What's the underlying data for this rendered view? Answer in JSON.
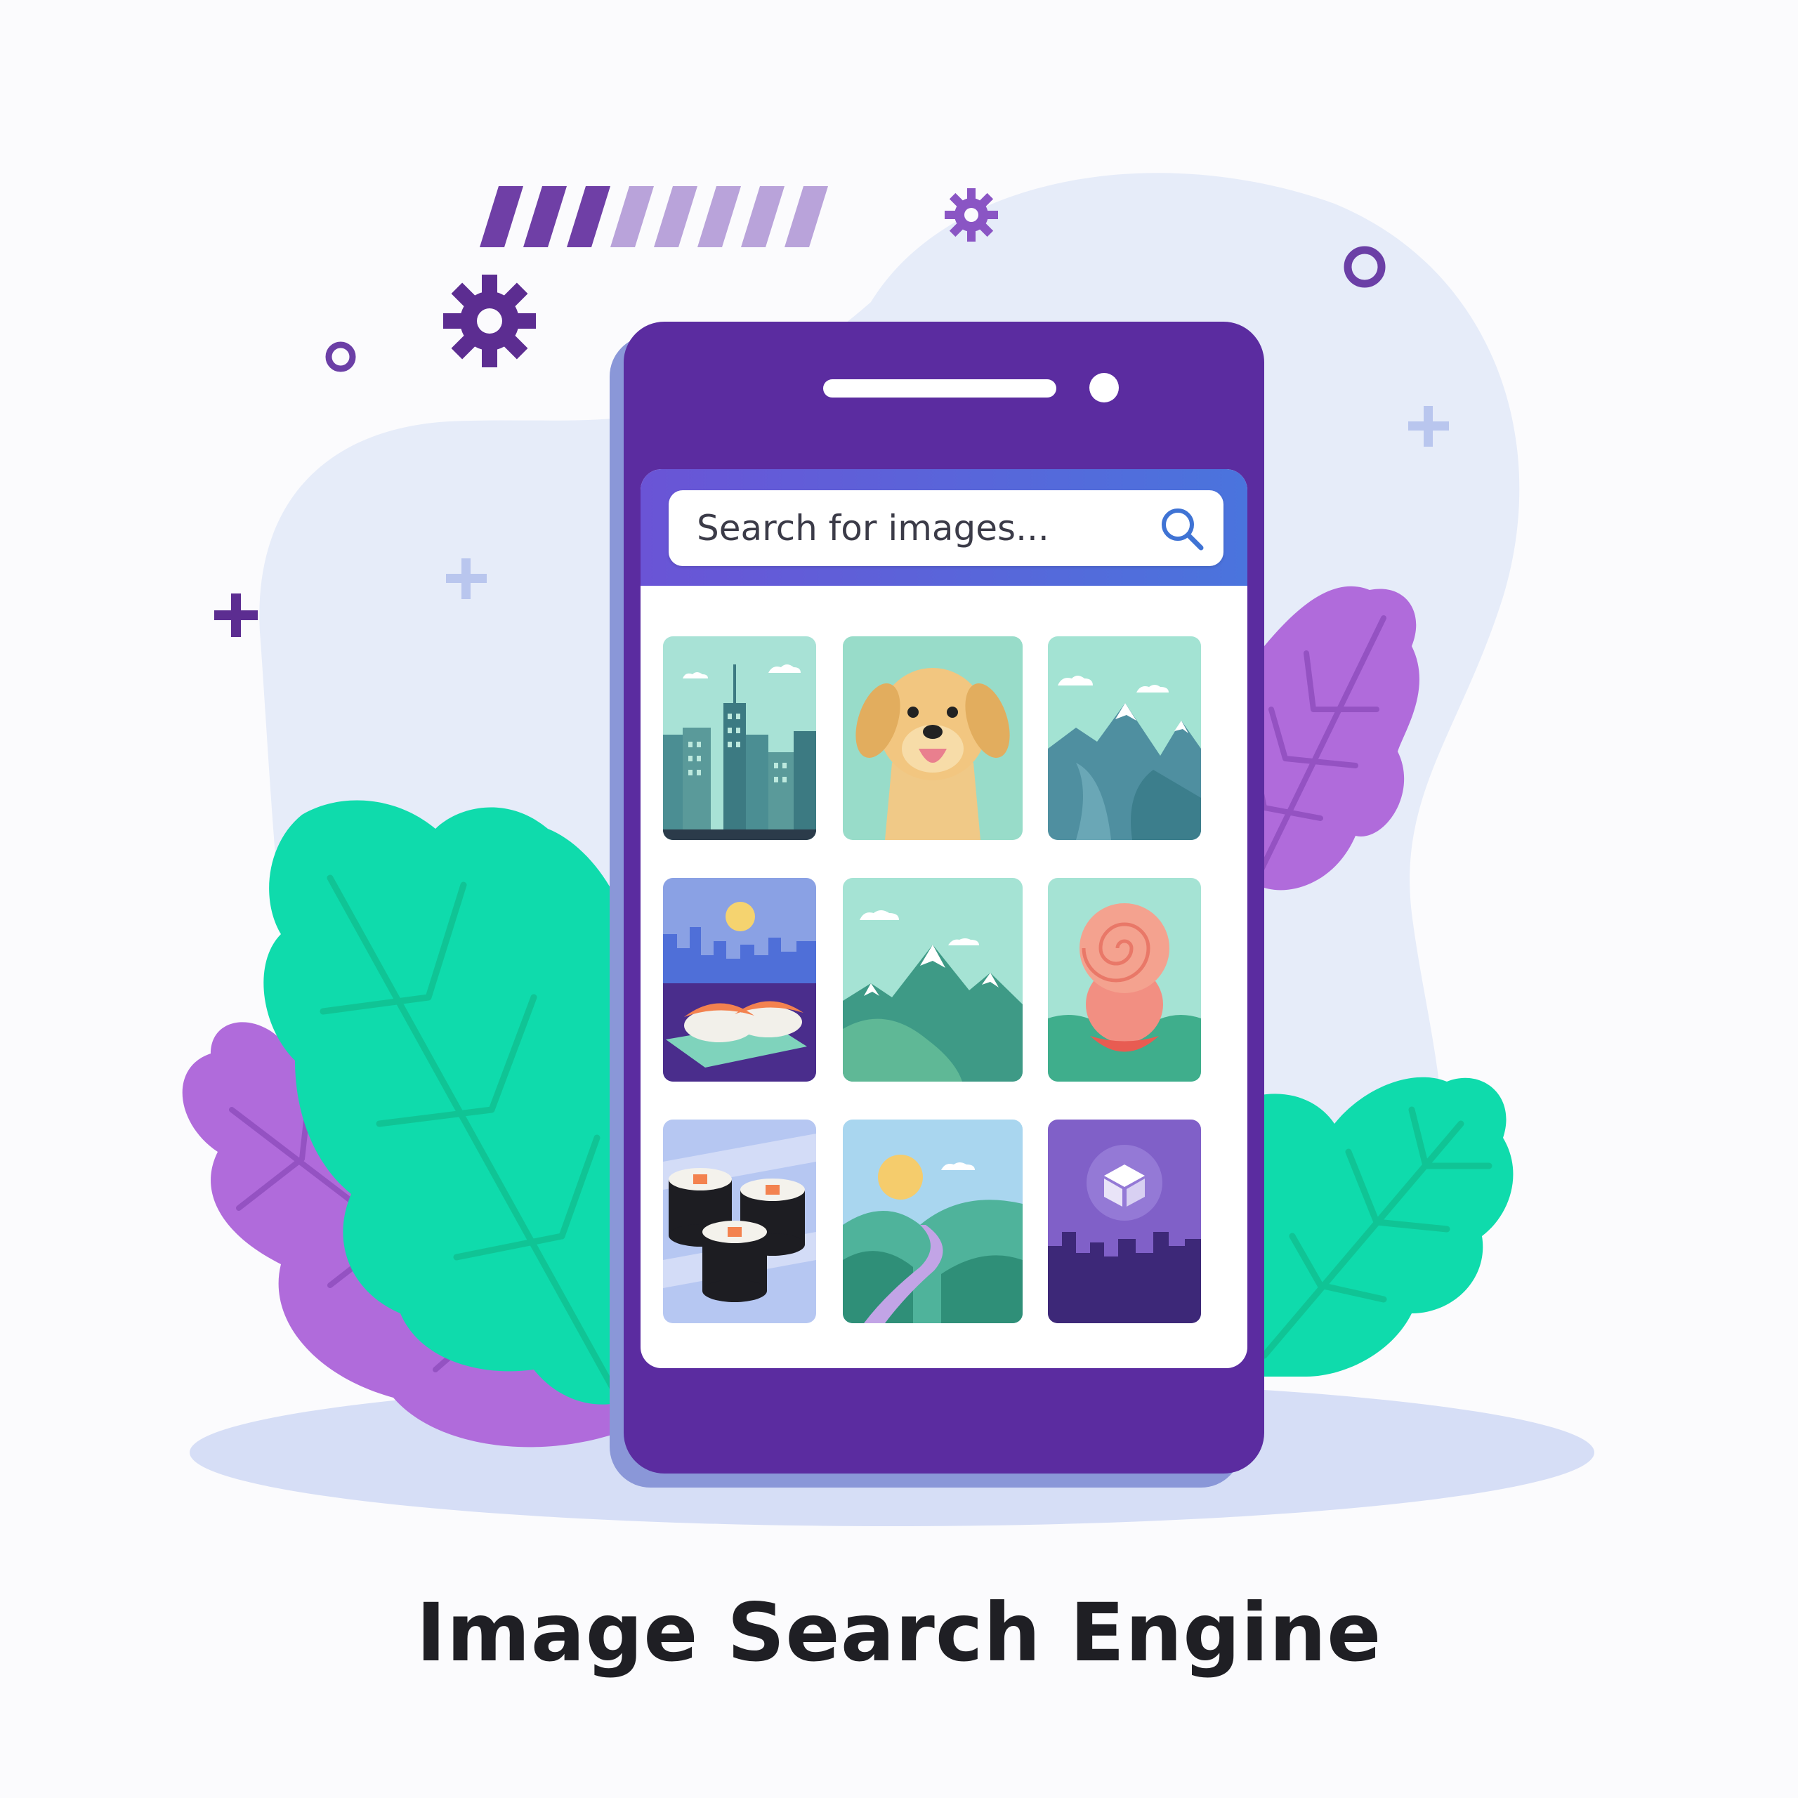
{
  "search": {
    "placeholder": "Search for images..."
  },
  "results": [
    {
      "icon": "city-skyline-image"
    },
    {
      "icon": "golden-retriever-image"
    },
    {
      "icon": "snowy-mountain-image"
    },
    {
      "icon": "sushi-city-image"
    },
    {
      "icon": "green-mountain-image"
    },
    {
      "icon": "spiral-dessert-image"
    },
    {
      "icon": "sushi-rolls-image"
    },
    {
      "icon": "river-valley-image"
    },
    {
      "icon": "purple-city-logo-image"
    }
  ],
  "title": "Image Search Engine",
  "colors": {
    "phone": "#5b2ca0",
    "accent_purple": "#6b3fa6",
    "leaf_green": "#0fdbac",
    "leaf_purple": "#b06bdb",
    "search_header": "#5a63d9"
  }
}
